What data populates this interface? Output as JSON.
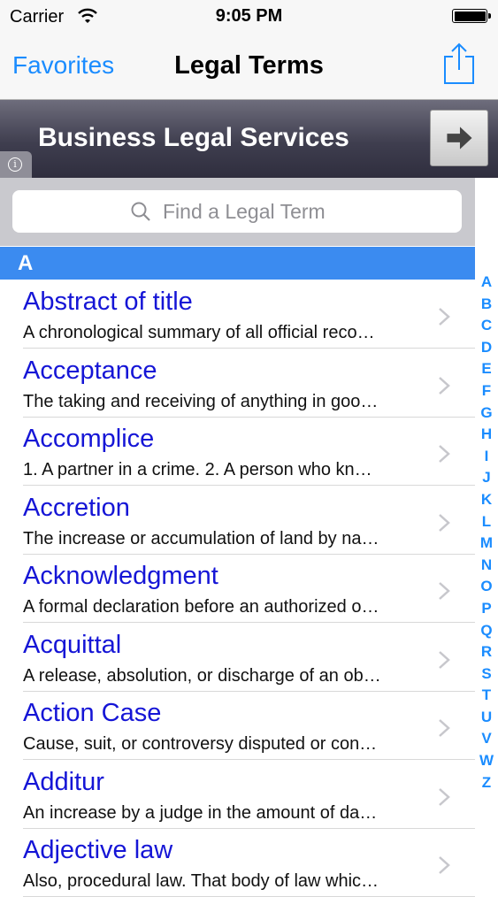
{
  "status": {
    "carrier": "Carrier",
    "time": "9:05 PM"
  },
  "navbar": {
    "favorites": "Favorites",
    "title": "Legal Terms"
  },
  "banner": {
    "title": "Business Legal Services"
  },
  "search": {
    "placeholder": "Find a Legal Term"
  },
  "section": {
    "letter": "A"
  },
  "terms": [
    {
      "name": "Abstract of title",
      "desc": "A chronological summary of all official reco…"
    },
    {
      "name": "Acceptance",
      "desc": "The taking and receiving of anything in goo…"
    },
    {
      "name": "Accomplice",
      "desc": "1. A partner in a crime. 2. A person who kn…"
    },
    {
      "name": "Accretion",
      "desc": "The increase or accumulation of land by na…"
    },
    {
      "name": "Acknowledgment",
      "desc": "A formal declaration before an authorized o…"
    },
    {
      "name": "Acquittal",
      "desc": "A release, absolution, or discharge of an ob…"
    },
    {
      "name": "Action Case",
      "desc": "Cause, suit, or controversy disputed or con…"
    },
    {
      "name": "Additur",
      "desc": "An increase by a judge in the amount of da…"
    },
    {
      "name": "Adjective law",
      "desc": "Also, procedural law. That body of law whic…"
    }
  ],
  "index": [
    "A",
    "B",
    "C",
    "D",
    "E",
    "F",
    "G",
    "H",
    "I",
    "J",
    "K",
    "L",
    "M",
    "N",
    "O",
    "P",
    "Q",
    "R",
    "S",
    "T",
    "U",
    "V",
    "W",
    "Z"
  ],
  "colors": {
    "accent": "#1a8cff",
    "term": "#1515d6",
    "section": "#3b8bf0"
  }
}
